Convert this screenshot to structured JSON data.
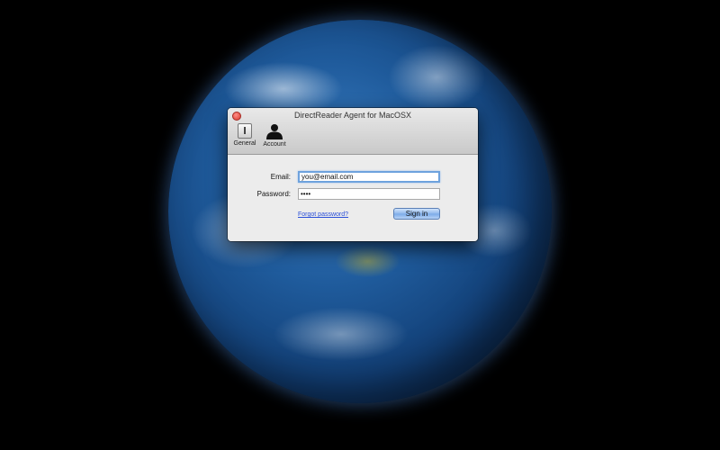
{
  "window": {
    "title": "DirectReader Agent for MacOSX"
  },
  "toolbar": {
    "items": [
      {
        "label": "General",
        "icon": "switch-icon"
      },
      {
        "label": "Account",
        "icon": "person-silhouette-icon"
      }
    ]
  },
  "form": {
    "email_label": "Email:",
    "email_value": "you@email.com",
    "password_label": "Password:",
    "password_value": "••••",
    "forgot_link": "Forgot password?",
    "sign_in_label": "Sign in"
  },
  "colors": {
    "accent": "#6ea2dd",
    "link": "#2a4fd8",
    "close": "#d8372d"
  }
}
